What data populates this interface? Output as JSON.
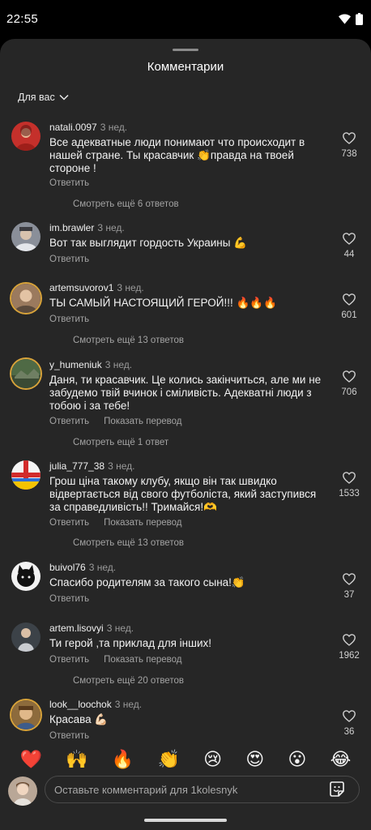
{
  "status_bar": {
    "time": "22:55"
  },
  "sheet": {
    "title": "Комментарии",
    "filter_label": "Для вас"
  },
  "comments": [
    {
      "username": "natali.0097",
      "time": "3 нед.",
      "text": "Все адекватные люди понимают что происходит в нашей стране. Ты красавчик 👏правда на твоей стороне !",
      "reply_label": "Ответить",
      "likes": "738",
      "view_replies": "Смотреть ещё 6 ответов",
      "avatar_color": "#c4302b"
    },
    {
      "username": "im.brawler",
      "time": "3 нед.",
      "text": "Вот так выглядит гордость Украины 💪",
      "reply_label": "Ответить",
      "likes": "44",
      "avatar_color": "#8a8f99"
    },
    {
      "username": "artemsuvorov1",
      "time": "3 нед.",
      "text": "ТЫ САМЫЙ НАСТОЯЩИЙ ГЕРОЙ!!! 🔥🔥🔥",
      "reply_label": "Ответить",
      "likes": "601",
      "view_replies": "Смотреть ещё 13 ответов",
      "avatar_color": "#9b7a5e"
    },
    {
      "username": "y_humeniuk",
      "time": "3 нед.",
      "text": "Даня, ти красавчик. Це колись закінчиться, але ми не забудемо твій вчинок і сміливість. Адекватні люди з тобою і за тебе!",
      "reply_label": "Ответить",
      "translate_label": "Показать перевод",
      "likes": "706",
      "view_replies": "Смотреть ещё 1 ответ",
      "avatar_color": "#4f6a45"
    },
    {
      "username": "julia_777_38",
      "time": "3 нед.",
      "text": "Грош ціна такому клубу, якщо він так швидко відвертається від свого футболіста, який заступився за справедливість!! Тримайся!🫶",
      "reply_label": "Ответить",
      "translate_label": "Показать перевод",
      "likes": "1533",
      "view_replies": "Смотреть ещё 13 ответов",
      "avatar_color": "#2f6fd6"
    },
    {
      "username": "buivol76",
      "time": "3 нед.",
      "text": "Спасибо родителям за такого сына!👏",
      "reply_label": "Ответить",
      "likes": "37",
      "avatar_color": "#f2f2f2"
    },
    {
      "username": "artem.lisovyi",
      "time": "3 нед.",
      "text": "Ти герой ,та приклад для інших!",
      "reply_label": "Ответить",
      "translate_label": "Показать перевод",
      "likes": "1962",
      "view_replies": "Смотреть ещё 20 ответов",
      "avatar_color": "#5e6a72"
    },
    {
      "username": "look__loochok",
      "time": "3 нед.",
      "text": "Красава 💪🏻",
      "reply_label": "Ответить",
      "likes": "36",
      "avatar_color": "#8d6b3c"
    }
  ],
  "reactions": [
    "❤️",
    "🙌",
    "🔥",
    "👏",
    "😢",
    "😍",
    "😮",
    "😂"
  ],
  "composer": {
    "placeholder": "Оставьте комментарий для 1kolesnyk"
  },
  "icons": {
    "heart": "heart-outline-icon",
    "sticker": "sticker-icon",
    "chevron": "chevron-down-icon",
    "wifi": "wifi-icon",
    "battery": "battery-icon"
  }
}
